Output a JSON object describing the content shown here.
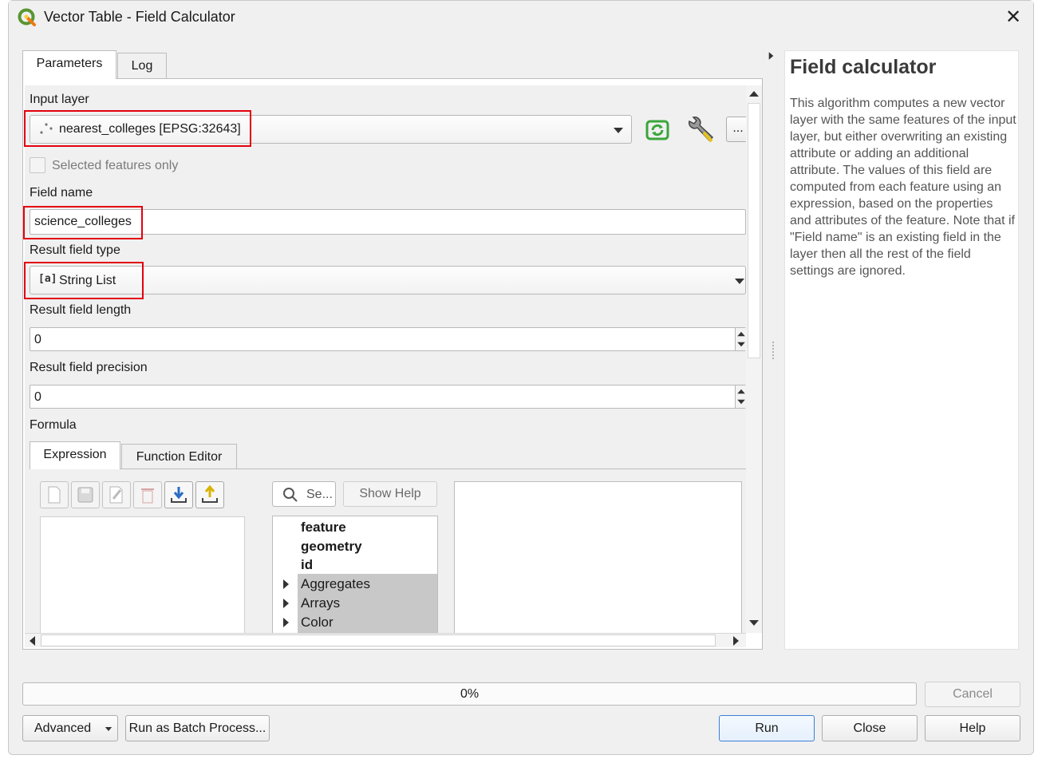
{
  "window": {
    "title": "Vector Table - Field Calculator",
    "close_glyph": "✕"
  },
  "tabs": {
    "parameters": "Parameters",
    "log": "Log"
  },
  "form": {
    "input_layer_label": "Input layer",
    "input_layer_value": "nearest_colleges [EPSG:32643]",
    "selected_only_label": "Selected features only",
    "field_name_label": "Field name",
    "field_name_value": "science_colleges",
    "result_type_label": "Result field type",
    "result_type_value": "String List",
    "result_type_icon_text": "[a]",
    "length_label": "Result field length",
    "length_value": "0",
    "precision_label": "Result field precision",
    "precision_value": "0",
    "formula_label": "Formula",
    "more_button": "..."
  },
  "formula_tabs": {
    "expression": "Expression",
    "function_editor": "Function Editor"
  },
  "expression": {
    "search_placeholder": "Se...",
    "show_help": "Show Help",
    "tree": [
      {
        "label": "feature",
        "bold": true,
        "expandable": false
      },
      {
        "label": "geometry",
        "bold": true,
        "expandable": false
      },
      {
        "label": "id",
        "bold": true,
        "expandable": false
      },
      {
        "label": "Aggregates",
        "bold": false,
        "expandable": true
      },
      {
        "label": "Arrays",
        "bold": false,
        "expandable": true
      },
      {
        "label": "Color",
        "bold": false,
        "expandable": true
      }
    ]
  },
  "help_panel": {
    "title": "Field calculator",
    "body": "This algorithm computes a new vector layer with the same features of the input layer, but either overwriting an existing attribute or adding an additional attribute. The values of this field are computed from each feature using an expression, based on the properties and attributes of the feature. Note that if \"Field name\" is an existing field in the layer then all the rest of the field settings are ignored."
  },
  "footer": {
    "progress_text": "0%",
    "progress": 0,
    "cancel": "Cancel",
    "advanced": "Advanced",
    "batch": "Run as Batch Process...",
    "run": "Run",
    "close": "Close",
    "help": "Help"
  },
  "colors": {
    "highlight": "#e3000f",
    "qgis_green": "#589632",
    "reload_green": "#3aa63a",
    "tree_group_bg": "#c8c8c8",
    "run_border": "#3c7fd6"
  }
}
